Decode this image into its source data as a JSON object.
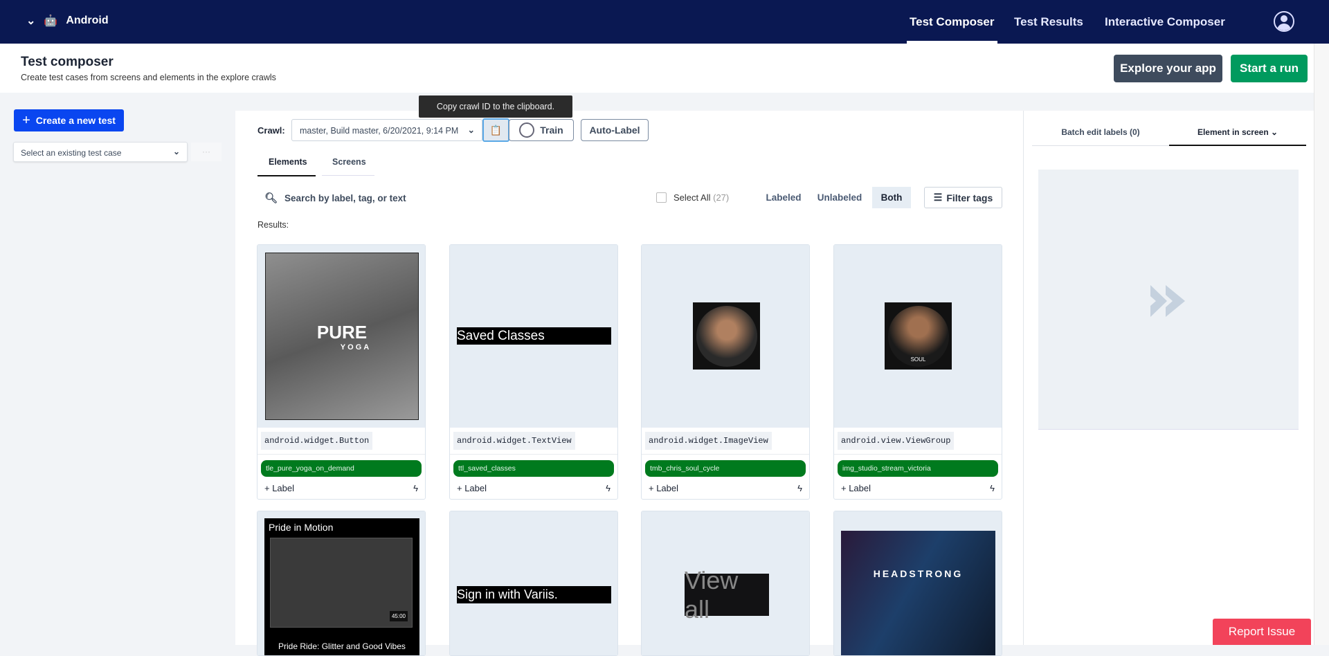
{
  "nav": {
    "platform": "Android",
    "tabs": [
      "Test Composer",
      "Test Results",
      "Interactive Composer"
    ],
    "active_tab": 0
  },
  "header": {
    "title": "Test composer",
    "subtitle": "Create test cases from screens and elements in the explore crawls",
    "explore": "Explore your app",
    "start": "Start a run"
  },
  "sidebar": {
    "create": "Create a new test",
    "select_placeholder": "Select an existing test case",
    "more": "···"
  },
  "toolbar": {
    "crawl_label": "Crawl:",
    "crawl_value": "master, Build master, 6/20/2021, 9:14 PM",
    "tooltip": "Copy crawl ID to the clipboard.",
    "train": "Train",
    "autolabel": "Auto-Label"
  },
  "tabs": [
    "Elements",
    "Screens"
  ],
  "filters": {
    "search_placeholder": "Search by label, tag, or text",
    "select_all": "Select All",
    "count": "(27)",
    "labeled": "Labeled",
    "unlabeled": "Unlabeled",
    "both": "Both",
    "filter_tags": "Filter tags",
    "results": "Results:"
  },
  "cards": [
    {
      "class": "android.widget.Button",
      "tag": "tle_pure_yoga_on_demand",
      "add_label": "+ Label",
      "image_text": "PURE",
      "image_sub": "YOGA"
    },
    {
      "class": "android.widget.TextView",
      "tag": "ttl_saved_classes",
      "add_label": "+ Label",
      "image_text": "Saved Classes"
    },
    {
      "class": "android.widget.ImageView",
      "tag": "tmb_chris_soul_cycle",
      "add_label": "+ Label"
    },
    {
      "class": "android.view.ViewGroup",
      "tag": "img_studio_stream_victoria",
      "add_label": "+ Label",
      "image_text": "SOUL"
    },
    {
      "image_text": "Pride in Motion",
      "image_sub": "Pride Ride: Glitter and Good Vibes",
      "duration": "45:00"
    },
    {
      "image_text": "Sign in with Variis."
    },
    {
      "image_text": "View all"
    },
    {
      "image_text": "HEADSTRONG"
    }
  ],
  "right_panel": {
    "batch": "Batch edit labels (0)",
    "element": "Element in screen"
  },
  "report": "Report Issue"
}
